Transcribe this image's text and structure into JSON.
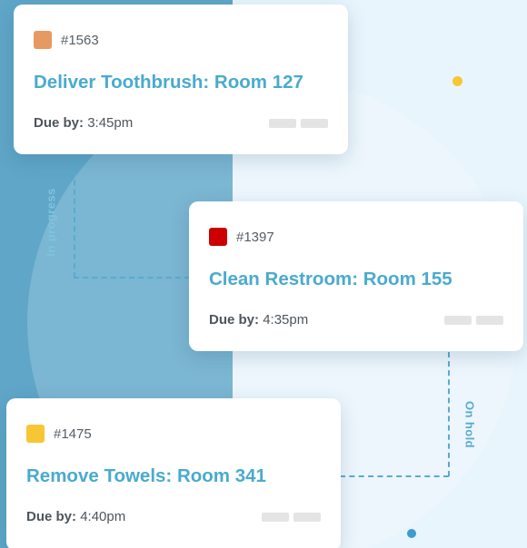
{
  "colors": {
    "left_panel": "#5fa6c8",
    "right_panel": "#e9f5fd",
    "accent_title": "#4aaace",
    "dashed_connector": "#5aaad0",
    "dot_yellow": "#f6c832",
    "dot_blue": "#3e9ccf"
  },
  "columns": {
    "in_progress_label": "In progress",
    "on_hold_label": "On hold"
  },
  "tasks": [
    {
      "id": "#1563",
      "swatch_color": "#e69a62",
      "title": "Deliver Toothbrush: Room 127",
      "due_label": "Due by:",
      "due_time": "3:45pm"
    },
    {
      "id": "#1397",
      "swatch_color": "#cc0000",
      "title": "Clean Restroom: Room 155",
      "due_label": "Due by:",
      "due_time": "4:35pm"
    },
    {
      "id": "#1475",
      "swatch_color": "#f7c634",
      "title": "Remove Towels: Room 341",
      "due_label": "Due by:",
      "due_time": "4:40pm"
    }
  ]
}
